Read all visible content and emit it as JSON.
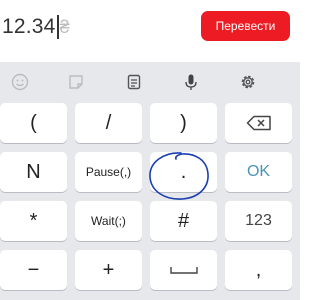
{
  "amount_input": {
    "value": "12.34",
    "currency_symbol": "₴"
  },
  "convert_button": {
    "label": "Перевести"
  },
  "toolbar": {
    "icons": [
      "emoji-icon",
      "sticker-icon",
      "clipboard-icon",
      "microphone-icon",
      "settings-icon"
    ]
  },
  "keys": {
    "row1": [
      "(",
      "/",
      ")",
      "backspace"
    ],
    "row2": [
      "N",
      "Pause(,)",
      ".",
      "OK"
    ],
    "row3": [
      "*",
      "Wait(;)",
      "#",
      "123"
    ],
    "row4": [
      "−",
      "+",
      "space",
      ","
    ]
  },
  "annotation": {
    "color": "#1a3fb0"
  }
}
